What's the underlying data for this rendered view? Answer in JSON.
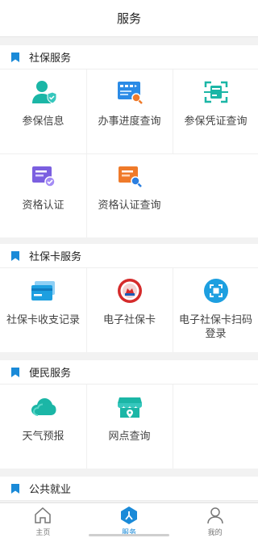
{
  "header": {
    "title": "服务"
  },
  "sections": [
    {
      "title": "社保服务",
      "items": [
        {
          "label": "参保信息",
          "icon": "person-shield-icon"
        },
        {
          "label": "办事进度查询",
          "icon": "progress-search-icon"
        },
        {
          "label": "参保凭证查询",
          "icon": "scan-document-icon"
        },
        {
          "label": "资格认证",
          "icon": "certificate-check-icon"
        },
        {
          "label": "资格认证查询",
          "icon": "certificate-search-icon"
        }
      ]
    },
    {
      "title": "社保卡服务",
      "items": [
        {
          "label": "社保卡收支记录",
          "icon": "card-icon"
        },
        {
          "label": "电子社保卡",
          "icon": "social-security-badge-icon"
        },
        {
          "label": "电子社保卡扫码登录",
          "icon": "scan-login-icon"
        }
      ]
    },
    {
      "title": "便民服务",
      "items": [
        {
          "label": "天气预报",
          "icon": "cloud-icon"
        },
        {
          "label": "网点查询",
          "icon": "store-location-icon"
        }
      ]
    },
    {
      "title": "公共就业",
      "items": []
    }
  ],
  "tabbar": [
    {
      "label": "主页",
      "icon": "home-icon",
      "active": false
    },
    {
      "label": "服务",
      "icon": "service-icon",
      "active": true
    },
    {
      "label": "我的",
      "icon": "user-icon",
      "active": false
    }
  ],
  "colors": {
    "accent": "#1a8ad8",
    "teal": "#1bb6a6",
    "purple": "#7b5fe0",
    "orange": "#ef7a2a",
    "blue": "#2b7fe0"
  }
}
